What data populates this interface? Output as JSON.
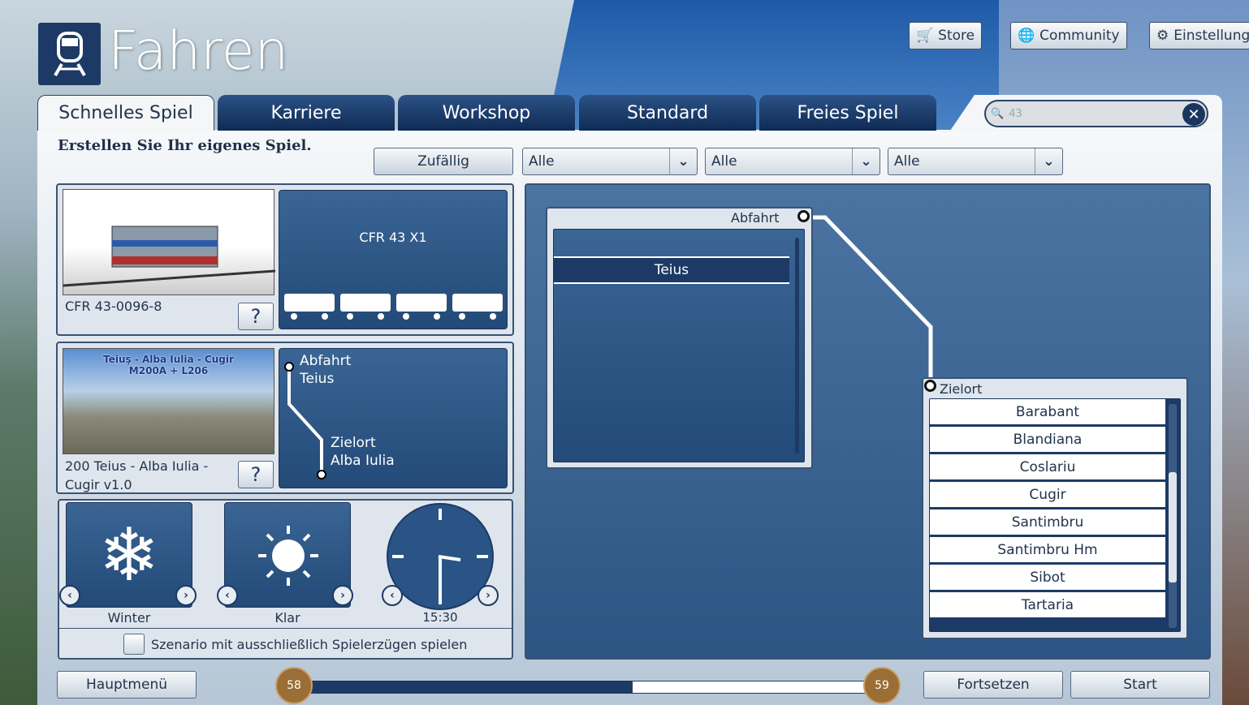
{
  "header": {
    "title": "Fahren",
    "icon": "train-icon"
  },
  "top_buttons": [
    {
      "label": "Store",
      "icon": "cart-icon"
    },
    {
      "label": "Community",
      "icon": "globe-icon"
    },
    {
      "label": "Einstellung",
      "icon": "gear-icon"
    }
  ],
  "tabs": [
    {
      "label": "Schnelles Spiel",
      "active": true
    },
    {
      "label": "Karriere"
    },
    {
      "label": "Workshop"
    },
    {
      "label": "Standard"
    },
    {
      "label": "Freies Spiel"
    }
  ],
  "search": {
    "value": "43"
  },
  "heading": "Erstellen Sie Ihr eigenes Spiel.",
  "filters": {
    "random_label": "Zufällig",
    "dropdowns": [
      "Alle",
      "Alle",
      "Alle"
    ]
  },
  "loco": {
    "name": "CFR 43-0096-8",
    "consist": "CFR 43 X1",
    "help": "?"
  },
  "route": {
    "name": "200 Teius - Alba Iulia - Cugir v1.0",
    "thumb_title": "Teiuş - Alba Iulia - Cugir",
    "thumb_sub": "M200A + L206",
    "departure_label": "Abfahrt",
    "departure": "Teius",
    "destination_label": "Zielort",
    "destination": "Alba Iulia",
    "help": "?"
  },
  "conditions": {
    "season": "Winter",
    "weather": "Klar",
    "time": "15:30"
  },
  "checkbox": {
    "label": "Szenario mit ausschließlich Spielerzügen spielen",
    "checked": false
  },
  "departure_panel": {
    "label": "Abfahrt",
    "items": [
      "",
      "Teius"
    ],
    "selected": "Teius"
  },
  "destination_panel": {
    "label": "Zielort",
    "items": [
      "Barabant",
      "Blandiana",
      "Coslariu",
      "Cugir",
      "Santimbru",
      "Santimbru Hm",
      "Sibot",
      "Tartaria"
    ]
  },
  "footer": {
    "main_menu": "Hauptmenü",
    "continue": "Fortsetzen",
    "start": "Start",
    "level_current": "58",
    "level_next": "59",
    "progress": 0.58
  },
  "colors": {
    "accent": "#1d3a66"
  }
}
